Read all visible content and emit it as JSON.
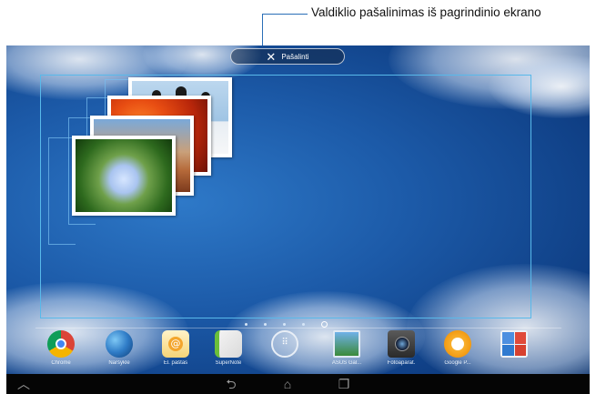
{
  "callout": {
    "text": "Valdiklio pašalinimas iš pagrindinio ekrano"
  },
  "remove_bar": {
    "label": "Pašalinti",
    "icon": "close-icon"
  },
  "dock": [
    {
      "name": "chrome",
      "label": "Chrome",
      "icon": "chrome-icon"
    },
    {
      "name": "browser",
      "label": "Naršyklė",
      "icon": "globe-icon"
    },
    {
      "name": "email",
      "label": "El. paštas",
      "icon": "mail-icon"
    },
    {
      "name": "notes",
      "label": "SuperNote",
      "icon": "notebook-icon"
    },
    {
      "name": "apps",
      "label": "",
      "icon": "app-drawer-icon"
    },
    {
      "name": "gallery",
      "label": "ASUS Gal...",
      "icon": "gallery-icon"
    },
    {
      "name": "camera",
      "label": "Fotoaparat.",
      "icon": "camera-icon"
    },
    {
      "name": "music",
      "label": "Google P...",
      "icon": "headphones-icon"
    },
    {
      "name": "google",
      "label": "",
      "icon": "google-apps-icon"
    }
  ],
  "navbar": {
    "home_icon": "home-icon",
    "back_icon": "back-icon",
    "recent_icon": "recent-apps-icon",
    "up_icon": "up-chevron-icon"
  },
  "colors": {
    "accent": "#58b9ea",
    "callout_line": "#2a6fb7"
  }
}
